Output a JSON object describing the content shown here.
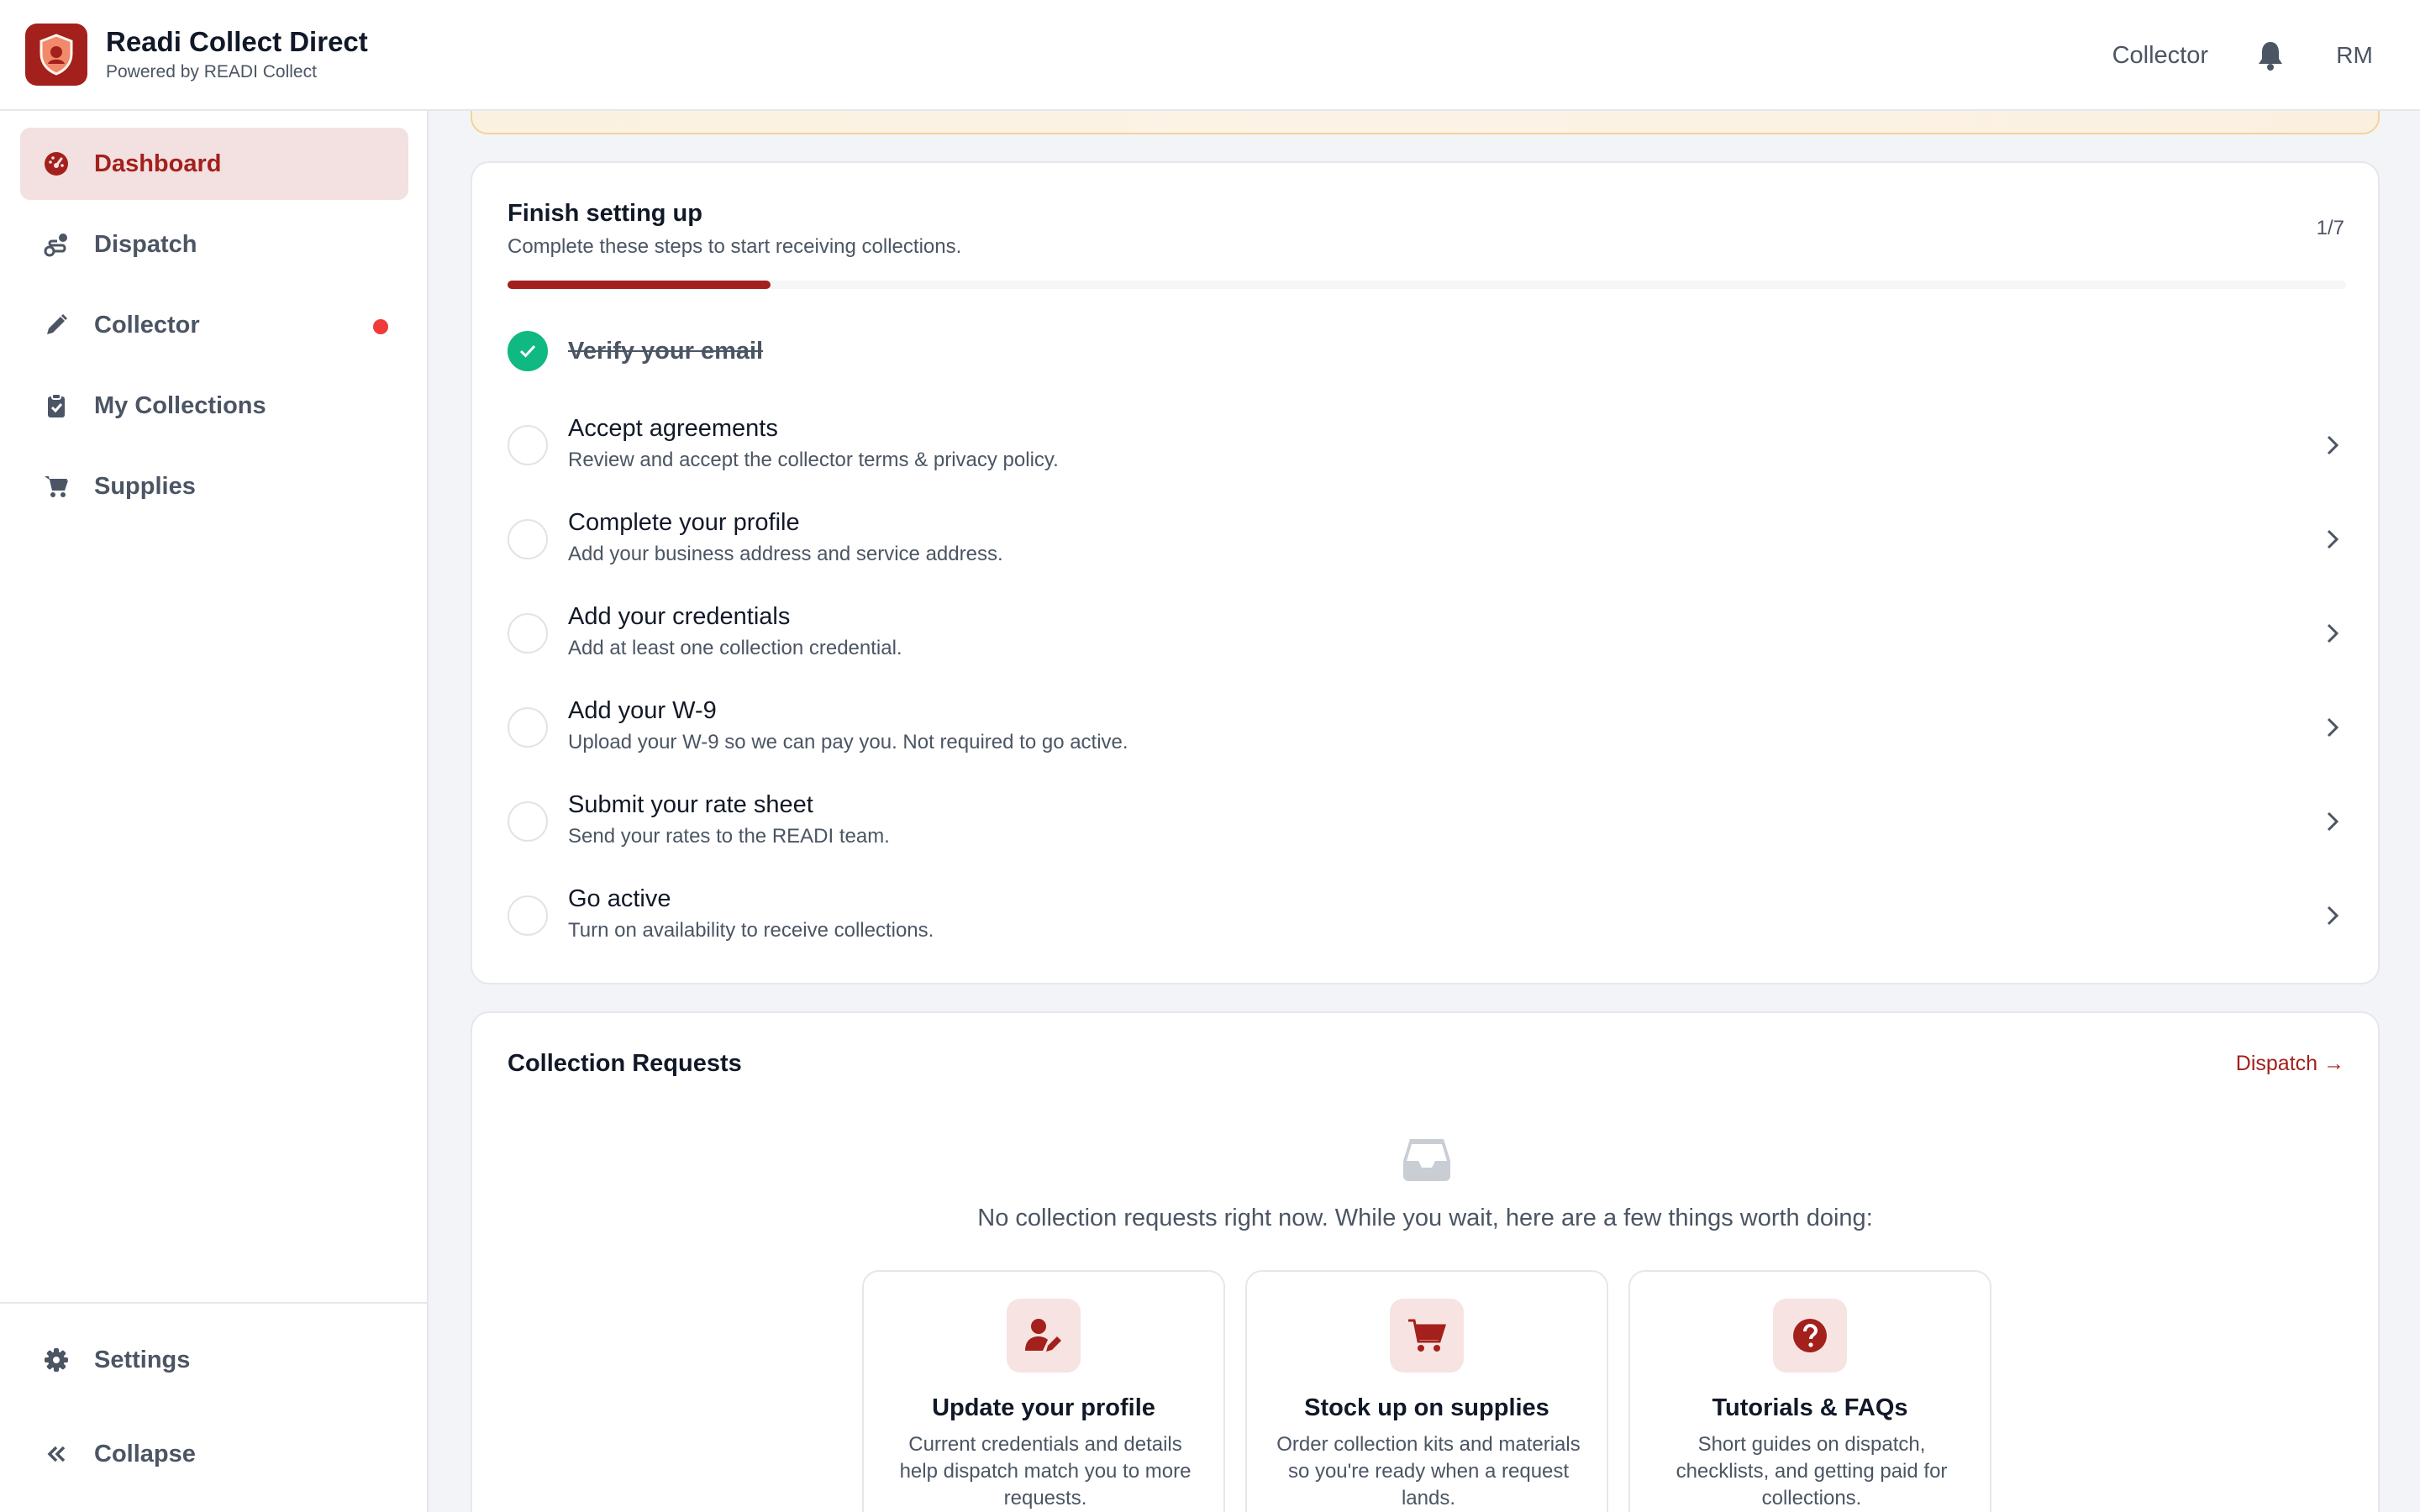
{
  "app": {
    "title": "Readi Collect Direct",
    "subtitle": "Powered by READI Collect"
  },
  "header": {
    "role_label": "Collector",
    "avatar_initials": "RM",
    "bell_icon": "bell-icon"
  },
  "sidebar": {
    "items": [
      {
        "label": "Dashboard",
        "icon": "dashboard-gauge-icon",
        "active": true
      },
      {
        "label": "Dispatch",
        "icon": "route-icon"
      },
      {
        "label": "Collector",
        "icon": "pencil-icon",
        "has_dot": true
      },
      {
        "label": "My Collections",
        "icon": "clipboard-check-icon"
      },
      {
        "label": "Supplies",
        "icon": "cart-icon"
      }
    ],
    "footer": [
      {
        "label": "Settings",
        "icon": "gear-icon"
      },
      {
        "label": "Collapse",
        "icon": "double-chevron-left-icon"
      }
    ]
  },
  "setup": {
    "title": "Finish setting up",
    "subtitle": "Complete these steps to start receiving collections.",
    "count": "1/7",
    "progress_fraction": 0.1429,
    "steps": [
      {
        "title": "Verify your email",
        "done": true
      },
      {
        "title": "Accept agreements",
        "desc": "Review and accept the collector terms & privacy policy."
      },
      {
        "title": "Complete your profile",
        "desc": "Add your business address and service address."
      },
      {
        "title": "Add your credentials",
        "desc": "Add at least one collection credential."
      },
      {
        "title": "Add your W-9",
        "desc": "Upload your W-9 so we can pay you. Not required to go active."
      },
      {
        "title": "Submit your rate sheet",
        "desc": "Send your rates to the READI team."
      },
      {
        "title": "Go active",
        "desc": "Turn on availability to receive collections."
      }
    ]
  },
  "requests": {
    "title": "Collection Requests",
    "link_label": "Dispatch →",
    "empty_message": "No collection requests right now. While you wait, here are a few things worth doing:",
    "tips": [
      {
        "title": "Update your profile",
        "text": "Current credentials and details help dispatch match you to more requests.",
        "icon": "user-edit-icon"
      },
      {
        "title": "Stock up on supplies",
        "text": "Order collection kits and materials so you're ready when a request lands.",
        "icon": "cart-icon"
      },
      {
        "title": "Tutorials & FAQs",
        "text": "Short guides on dispatch, checklists, and getting paid for collections.",
        "icon": "question-circle-icon"
      }
    ]
  },
  "colors": {
    "brand": "#a3201c",
    "success": "#10b981",
    "alert_dot": "#ef3b3b"
  }
}
